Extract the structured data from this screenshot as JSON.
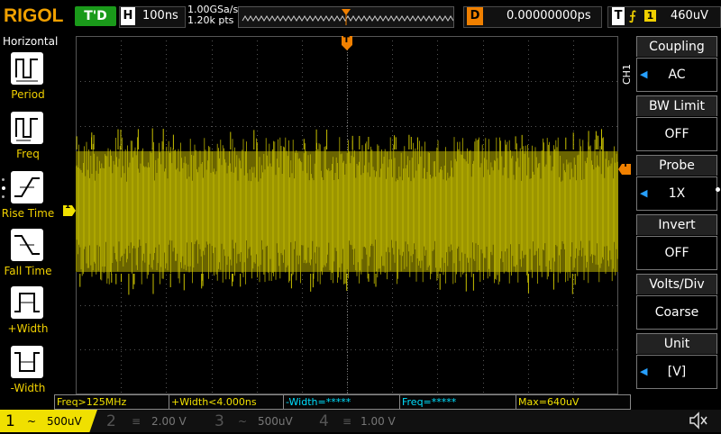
{
  "brand": "RIGOL",
  "run_state": "T'D",
  "horizontal": {
    "label": "H",
    "timebase": "100ns",
    "sample_rate": "1.00GSa/s",
    "memory_depth": "1.20k pts"
  },
  "delay": {
    "label": "D",
    "value": "0.00000000ps"
  },
  "trigger": {
    "label": "T",
    "edge": "rising",
    "source": "1",
    "level": "460uV"
  },
  "left_menu": {
    "title": "Horizontal",
    "items": [
      "Period",
      "Freq",
      "Rise Time",
      "Fall Time",
      "+Width",
      "-Width"
    ]
  },
  "right_menu": {
    "channel_tab": "CH1",
    "items": [
      {
        "title": "Coupling",
        "value": "AC",
        "has_arrow": true
      },
      {
        "title": "BW Limit",
        "value": "OFF",
        "has_arrow": false
      },
      {
        "title": "Probe",
        "value": "1X",
        "has_arrow": true
      },
      {
        "title": "Invert",
        "value": "OFF",
        "has_arrow": false
      },
      {
        "title": "Volts/Div",
        "value": "Coarse",
        "has_arrow": false
      },
      {
        "title": "Unit",
        "value": "[V]",
        "has_arrow": true
      }
    ]
  },
  "measurements": [
    "Freq>125MHz",
    "+Width<4.000ns",
    "-Width=*****",
    "Freq=*****",
    "Max=640uV"
  ],
  "channels": [
    {
      "num": "1",
      "scale": "500uV",
      "active": true
    },
    {
      "num": "2",
      "scale": "2.00 V",
      "active": false
    },
    {
      "num": "3",
      "scale": "500uV",
      "active": false
    },
    {
      "num": "4",
      "scale": "1.00 V",
      "active": false
    }
  ],
  "markers": {
    "ch1": "1",
    "trigger_top": "T",
    "trigger_level": "T"
  },
  "colors": {
    "ch1": "#f0e000",
    "ch2": "#00e0ff",
    "ch3": "#ff00ff",
    "ch4": "#2060ff",
    "trace": "#c8c000",
    "accent": "#f08000",
    "run": "#1a9a1a"
  }
}
